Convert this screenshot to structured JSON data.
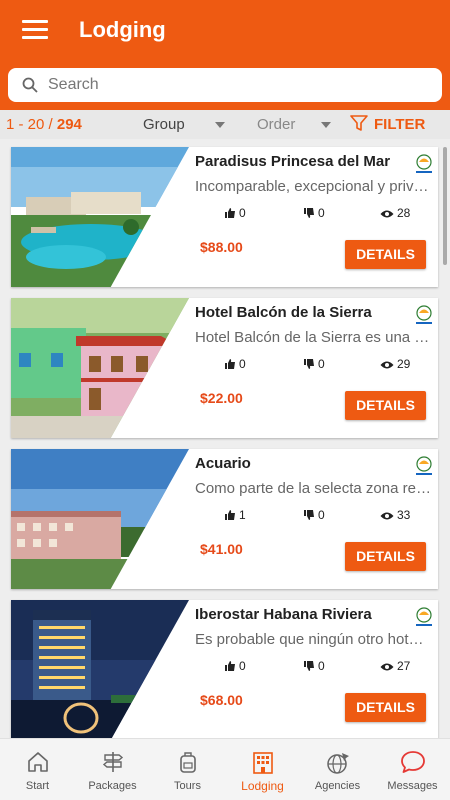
{
  "header": {
    "title": "Lodging"
  },
  "search": {
    "placeholder": "Search"
  },
  "filterbar": {
    "range": "1 - 20 / ",
    "total": "294",
    "group_label": "Group",
    "order_label": "Order",
    "filter_label": "FILTER"
  },
  "hotels": [
    {
      "name": "Paradisus Princesa del Mar",
      "description": "Incomparable, excepcional y privilegiado",
      "likes": "0",
      "dislikes": "0",
      "views": "28",
      "price": "$88.00",
      "details_label": "DETAILS"
    },
    {
      "name": "Hotel Balcón de la Sierra",
      "description": "Hotel Balcón de la Sierra es una opción",
      "likes": "0",
      "dislikes": "0",
      "views": "29",
      "price": "$22.00",
      "details_label": "DETAILS"
    },
    {
      "name": "Acuario",
      "description": "Como parte de la selecta zona residencial",
      "likes": "1",
      "dislikes": "0",
      "views": "33",
      "price": "$41.00",
      "details_label": "DETAILS"
    },
    {
      "name": "Iberostar Habana Riviera",
      "description": "Es probable que ningún otro hotel de La",
      "likes": "0",
      "dislikes": "0",
      "views": "27",
      "price": "$68.00",
      "details_label": "DETAILS"
    }
  ],
  "nav": {
    "start": "Start",
    "packages": "Packages",
    "tours": "Tours",
    "lodging": "Lodging",
    "agencies": "Agencies",
    "messages": "Messages"
  },
  "colors": {
    "accent": "#ee5a12",
    "price": "#e64a19"
  }
}
